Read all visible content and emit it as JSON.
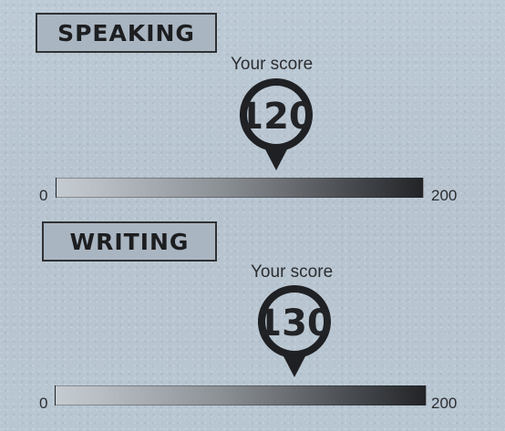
{
  "sections": [
    {
      "title": "SPEAKING",
      "caption": "Your score",
      "score": "120",
      "min_label": "0",
      "max_label": "200"
    },
    {
      "title": "WRITING",
      "caption": "Your score",
      "score": "130",
      "min_label": "0",
      "max_label": "200"
    }
  ]
}
